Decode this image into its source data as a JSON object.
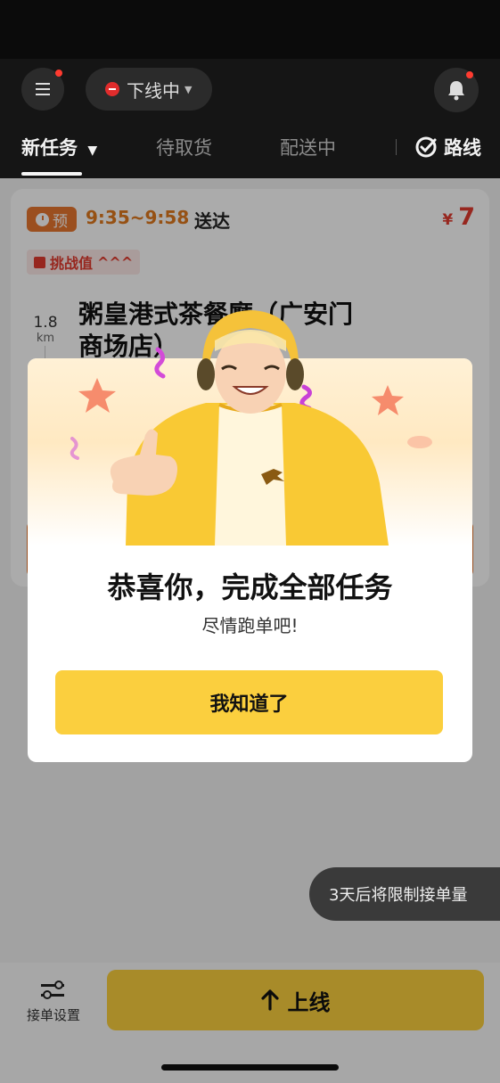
{
  "header": {
    "status_label": "下线中",
    "tabs": [
      {
        "label": "新任务"
      },
      {
        "label": "待取货"
      },
      {
        "label": "配送中"
      }
    ],
    "route_label": "路线"
  },
  "order_card": {
    "badge_label": "预",
    "time_window": "9:35~9:58",
    "delivery_label": "送达",
    "currency": "¥",
    "price": "7",
    "challenge_label": "挑战值",
    "challenge_level": "^^^",
    "distance": "1.8",
    "distance_unit": "km",
    "shop_name_line1": "粥皇港式茶餐廳（广安门",
    "shop_name_line2": "商场店）"
  },
  "modal": {
    "title": "恭喜你，完成全部任务",
    "subtitle": "尽情跑单吧!",
    "confirm_label": "我知道了"
  },
  "toast": {
    "text": "3天后将限制接单量"
  },
  "footer": {
    "settings_label": "接单设置",
    "online_label": "上线"
  },
  "colors": {
    "accent_yellow": "#fbcf3e",
    "price_red": "#e23b2f",
    "orange": "#e8762f"
  }
}
